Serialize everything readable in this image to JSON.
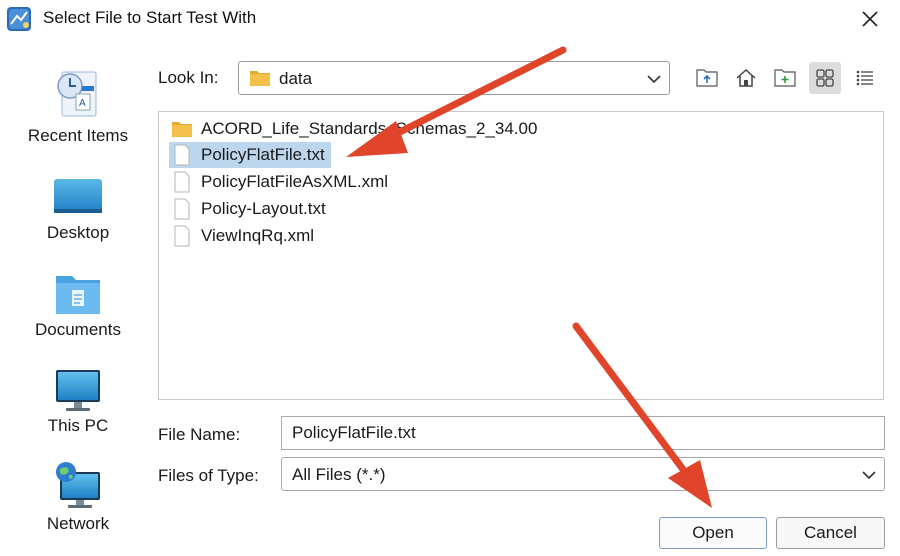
{
  "window": {
    "title": "Select File to Start Test With",
    "app_icon": "app-logo-icon",
    "close_icon": "close-icon"
  },
  "places": [
    {
      "label": "Recent Items",
      "icon": "recent-items-icon"
    },
    {
      "label": "Desktop",
      "icon": "desktop-icon"
    },
    {
      "label": "Documents",
      "icon": "documents-folder-icon"
    },
    {
      "label": "This PC",
      "icon": "computer-icon"
    },
    {
      "label": "Network",
      "icon": "network-globe-icon"
    }
  ],
  "look_in": {
    "label": "Look In:",
    "value": "data",
    "folder_icon": "folder-icon"
  },
  "toolbar": {
    "buttons": [
      {
        "name": "up-one-level",
        "icon": "folder-up-icon"
      },
      {
        "name": "home",
        "icon": "home-icon"
      },
      {
        "name": "new-folder",
        "icon": "new-folder-icon"
      },
      {
        "name": "list-view",
        "icon": "grid-view-icon",
        "active": true
      },
      {
        "name": "details-view",
        "icon": "details-list-icon"
      }
    ]
  },
  "files": [
    {
      "name": "ACORD_Life_Standards_Schemas_2_34.00",
      "type": "folder",
      "icon": "folder-icon"
    },
    {
      "name": "PolicyFlatFile.txt",
      "type": "file",
      "icon": "file-icon",
      "selected": true
    },
    {
      "name": "PolicyFlatFileAsXML.xml",
      "type": "file",
      "icon": "file-icon"
    },
    {
      "name": "Policy-Layout.txt",
      "type": "file",
      "icon": "file-icon"
    },
    {
      "name": "ViewInqRq.xml",
      "type": "file",
      "icon": "file-icon"
    }
  ],
  "file_name": {
    "label": "File Name:",
    "value": "PolicyFlatFile.txt"
  },
  "file_type": {
    "label": "Files of Type:",
    "value": "All Files (*.*)"
  },
  "buttons": {
    "open": "Open",
    "cancel": "Cancel"
  },
  "colors": {
    "selection": "#bcd6ee",
    "annotation_arrow": "#e0452b",
    "folder": "#f3c04a"
  }
}
